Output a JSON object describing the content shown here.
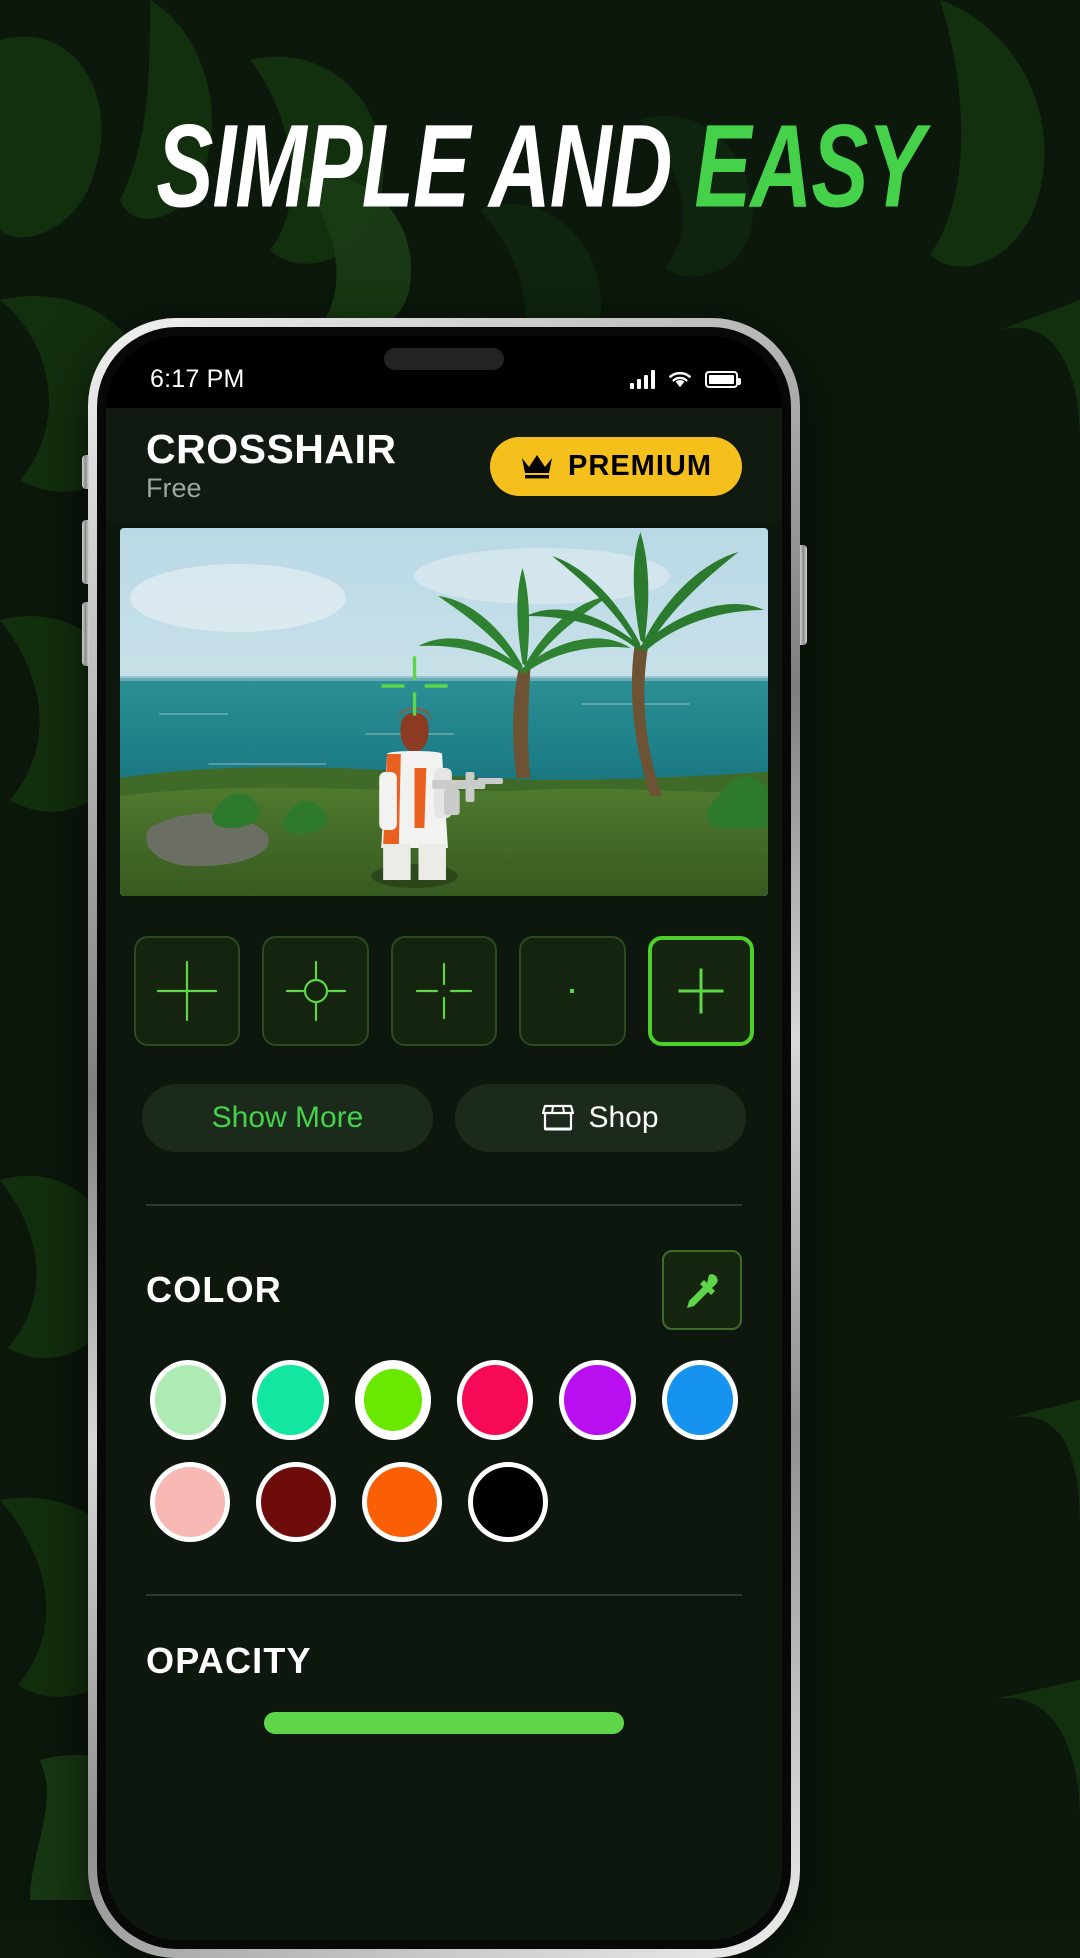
{
  "promo": {
    "headline_white": "SIMPLE AND ",
    "headline_green": "EASY",
    "accent_green": "#46d14b",
    "background": "#0c180c"
  },
  "phone": {
    "status_bar": {
      "time": "6:17 PM",
      "signal_icon": "cellular-signal-icon",
      "wifi_icon": "wifi-icon",
      "battery_icon": "battery-full-icon"
    },
    "header": {
      "title": "CROSSHAIR",
      "subtitle": "Free",
      "premium_label": "PREMIUM",
      "premium_icon": "crown-icon",
      "premium_color": "#f6c01c"
    },
    "preview": {
      "name": "game-preview-image",
      "description": "Third-person shooter gameplay on a tropical island with palm trees and ocean",
      "crosshair_color": "#5fd64a"
    },
    "presets": {
      "items": [
        {
          "name": "preset-large-cross",
          "icon": "crosshair-large-cross-icon",
          "selected": false
        },
        {
          "name": "preset-circle-cross",
          "icon": "crosshair-circle-cross-icon",
          "selected": false
        },
        {
          "name": "preset-gap-cross",
          "icon": "crosshair-gap-cross-icon",
          "selected": false
        },
        {
          "name": "preset-dot",
          "icon": "crosshair-dot-icon",
          "selected": false
        },
        {
          "name": "preset-small-cross",
          "icon": "crosshair-small-cross-icon",
          "selected": true
        }
      ],
      "selected_index": 4,
      "selected_border_color": "#4dd029"
    },
    "actions": {
      "show_more_label": "Show More",
      "shop_label": "Shop",
      "shop_icon": "storefront-icon"
    },
    "color_section": {
      "label": "COLOR",
      "eyedropper_icon": "eyedropper-icon",
      "swatches_row1": [
        {
          "name": "swatch-mint",
          "hex": "#aeeab4",
          "selected": false
        },
        {
          "name": "swatch-spring-green",
          "hex": "#12e6a0",
          "selected": false
        },
        {
          "name": "swatch-lime",
          "hex": "#69e800",
          "selected": true
        },
        {
          "name": "swatch-pink-red",
          "hex": "#f70a55",
          "selected": false
        },
        {
          "name": "swatch-magenta",
          "hex": "#b90ef0",
          "selected": false
        },
        {
          "name": "swatch-blue",
          "hex": "#1593ef",
          "selected": false
        }
      ],
      "swatches_row2": [
        {
          "name": "swatch-light-pink",
          "hex": "#f8b9b5",
          "selected": false
        },
        {
          "name": "swatch-dark-red",
          "hex": "#6e0c0c",
          "selected": false
        },
        {
          "name": "swatch-orange",
          "hex": "#fa5f06",
          "selected": false
        },
        {
          "name": "swatch-black",
          "hex": "#000000",
          "selected": false
        }
      ]
    },
    "opacity_section": {
      "label": "OPACITY"
    }
  }
}
